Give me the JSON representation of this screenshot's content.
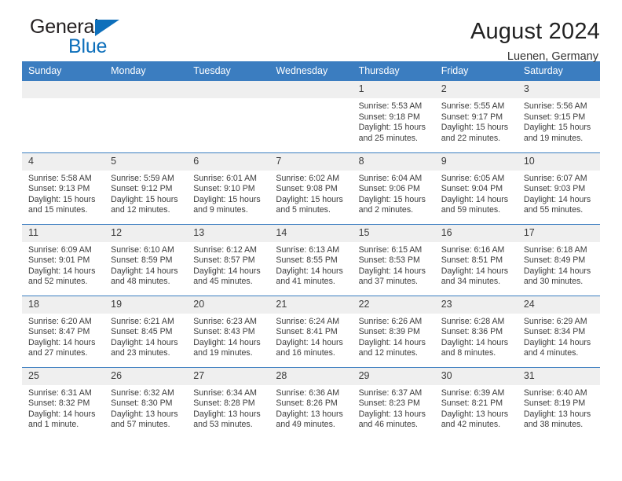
{
  "brand": {
    "name_top": "General",
    "name_bottom": "Blue",
    "triangle_color": "#0d6fbb"
  },
  "header": {
    "title": "August 2024",
    "location": "Luenen, Germany"
  },
  "theme": {
    "header_blue": "#3b7dc0",
    "daynum_band": "#efefef",
    "text": "#3b3b3b"
  },
  "weekday_headers": [
    "Sunday",
    "Monday",
    "Tuesday",
    "Wednesday",
    "Thursday",
    "Friday",
    "Saturday"
  ],
  "labels": {
    "sunrise": "Sunrise:",
    "sunset": "Sunset:",
    "daylight": "Daylight:"
  },
  "weeks": [
    [
      {
        "empty": true
      },
      {
        "empty": true
      },
      {
        "empty": true
      },
      {
        "empty": true
      },
      {
        "day": "1",
        "sunrise": "Sunrise: 5:53 AM",
        "sunset": "Sunset: 9:18 PM",
        "daylight1": "Daylight: 15 hours",
        "daylight2": "and 25 minutes."
      },
      {
        "day": "2",
        "sunrise": "Sunrise: 5:55 AM",
        "sunset": "Sunset: 9:17 PM",
        "daylight1": "Daylight: 15 hours",
        "daylight2": "and 22 minutes."
      },
      {
        "day": "3",
        "sunrise": "Sunrise: 5:56 AM",
        "sunset": "Sunset: 9:15 PM",
        "daylight1": "Daylight: 15 hours",
        "daylight2": "and 19 minutes."
      }
    ],
    [
      {
        "day": "4",
        "sunrise": "Sunrise: 5:58 AM",
        "sunset": "Sunset: 9:13 PM",
        "daylight1": "Daylight: 15 hours",
        "daylight2": "and 15 minutes."
      },
      {
        "day": "5",
        "sunrise": "Sunrise: 5:59 AM",
        "sunset": "Sunset: 9:12 PM",
        "daylight1": "Daylight: 15 hours",
        "daylight2": "and 12 minutes."
      },
      {
        "day": "6",
        "sunrise": "Sunrise: 6:01 AM",
        "sunset": "Sunset: 9:10 PM",
        "daylight1": "Daylight: 15 hours",
        "daylight2": "and 9 minutes."
      },
      {
        "day": "7",
        "sunrise": "Sunrise: 6:02 AM",
        "sunset": "Sunset: 9:08 PM",
        "daylight1": "Daylight: 15 hours",
        "daylight2": "and 5 minutes."
      },
      {
        "day": "8",
        "sunrise": "Sunrise: 6:04 AM",
        "sunset": "Sunset: 9:06 PM",
        "daylight1": "Daylight: 15 hours",
        "daylight2": "and 2 minutes."
      },
      {
        "day": "9",
        "sunrise": "Sunrise: 6:05 AM",
        "sunset": "Sunset: 9:04 PM",
        "daylight1": "Daylight: 14 hours",
        "daylight2": "and 59 minutes."
      },
      {
        "day": "10",
        "sunrise": "Sunrise: 6:07 AM",
        "sunset": "Sunset: 9:03 PM",
        "daylight1": "Daylight: 14 hours",
        "daylight2": "and 55 minutes."
      }
    ],
    [
      {
        "day": "11",
        "sunrise": "Sunrise: 6:09 AM",
        "sunset": "Sunset: 9:01 PM",
        "daylight1": "Daylight: 14 hours",
        "daylight2": "and 52 minutes."
      },
      {
        "day": "12",
        "sunrise": "Sunrise: 6:10 AM",
        "sunset": "Sunset: 8:59 PM",
        "daylight1": "Daylight: 14 hours",
        "daylight2": "and 48 minutes."
      },
      {
        "day": "13",
        "sunrise": "Sunrise: 6:12 AM",
        "sunset": "Sunset: 8:57 PM",
        "daylight1": "Daylight: 14 hours",
        "daylight2": "and 45 minutes."
      },
      {
        "day": "14",
        "sunrise": "Sunrise: 6:13 AM",
        "sunset": "Sunset: 8:55 PM",
        "daylight1": "Daylight: 14 hours",
        "daylight2": "and 41 minutes."
      },
      {
        "day": "15",
        "sunrise": "Sunrise: 6:15 AM",
        "sunset": "Sunset: 8:53 PM",
        "daylight1": "Daylight: 14 hours",
        "daylight2": "and 37 minutes."
      },
      {
        "day": "16",
        "sunrise": "Sunrise: 6:16 AM",
        "sunset": "Sunset: 8:51 PM",
        "daylight1": "Daylight: 14 hours",
        "daylight2": "and 34 minutes."
      },
      {
        "day": "17",
        "sunrise": "Sunrise: 6:18 AM",
        "sunset": "Sunset: 8:49 PM",
        "daylight1": "Daylight: 14 hours",
        "daylight2": "and 30 minutes."
      }
    ],
    [
      {
        "day": "18",
        "sunrise": "Sunrise: 6:20 AM",
        "sunset": "Sunset: 8:47 PM",
        "daylight1": "Daylight: 14 hours",
        "daylight2": "and 27 minutes."
      },
      {
        "day": "19",
        "sunrise": "Sunrise: 6:21 AM",
        "sunset": "Sunset: 8:45 PM",
        "daylight1": "Daylight: 14 hours",
        "daylight2": "and 23 minutes."
      },
      {
        "day": "20",
        "sunrise": "Sunrise: 6:23 AM",
        "sunset": "Sunset: 8:43 PM",
        "daylight1": "Daylight: 14 hours",
        "daylight2": "and 19 minutes."
      },
      {
        "day": "21",
        "sunrise": "Sunrise: 6:24 AM",
        "sunset": "Sunset: 8:41 PM",
        "daylight1": "Daylight: 14 hours",
        "daylight2": "and 16 minutes."
      },
      {
        "day": "22",
        "sunrise": "Sunrise: 6:26 AM",
        "sunset": "Sunset: 8:39 PM",
        "daylight1": "Daylight: 14 hours",
        "daylight2": "and 12 minutes."
      },
      {
        "day": "23",
        "sunrise": "Sunrise: 6:28 AM",
        "sunset": "Sunset: 8:36 PM",
        "daylight1": "Daylight: 14 hours",
        "daylight2": "and 8 minutes."
      },
      {
        "day": "24",
        "sunrise": "Sunrise: 6:29 AM",
        "sunset": "Sunset: 8:34 PM",
        "daylight1": "Daylight: 14 hours",
        "daylight2": "and 4 minutes."
      }
    ],
    [
      {
        "day": "25",
        "sunrise": "Sunrise: 6:31 AM",
        "sunset": "Sunset: 8:32 PM",
        "daylight1": "Daylight: 14 hours",
        "daylight2": "and 1 minute."
      },
      {
        "day": "26",
        "sunrise": "Sunrise: 6:32 AM",
        "sunset": "Sunset: 8:30 PM",
        "daylight1": "Daylight: 13 hours",
        "daylight2": "and 57 minutes."
      },
      {
        "day": "27",
        "sunrise": "Sunrise: 6:34 AM",
        "sunset": "Sunset: 8:28 PM",
        "daylight1": "Daylight: 13 hours",
        "daylight2": "and 53 minutes."
      },
      {
        "day": "28",
        "sunrise": "Sunrise: 6:36 AM",
        "sunset": "Sunset: 8:26 PM",
        "daylight1": "Daylight: 13 hours",
        "daylight2": "and 49 minutes."
      },
      {
        "day": "29",
        "sunrise": "Sunrise: 6:37 AM",
        "sunset": "Sunset: 8:23 PM",
        "daylight1": "Daylight: 13 hours",
        "daylight2": "and 46 minutes."
      },
      {
        "day": "30",
        "sunrise": "Sunrise: 6:39 AM",
        "sunset": "Sunset: 8:21 PM",
        "daylight1": "Daylight: 13 hours",
        "daylight2": "and 42 minutes."
      },
      {
        "day": "31",
        "sunrise": "Sunrise: 6:40 AM",
        "sunset": "Sunset: 8:19 PM",
        "daylight1": "Daylight: 13 hours",
        "daylight2": "and 38 minutes."
      }
    ]
  ]
}
